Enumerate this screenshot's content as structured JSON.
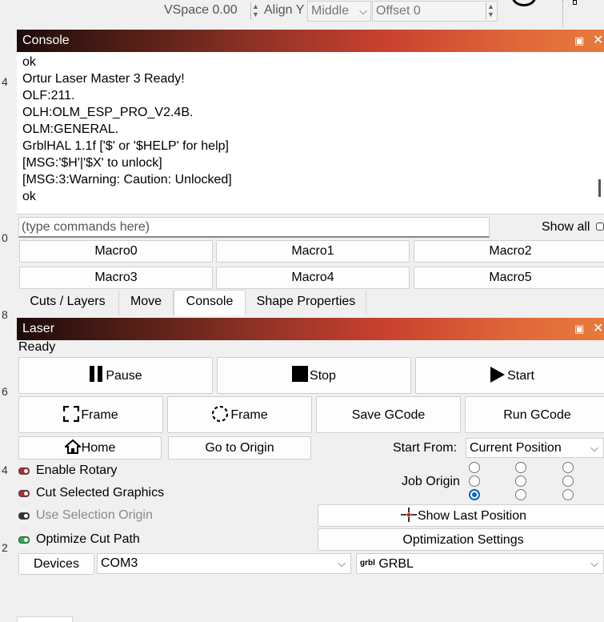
{
  "toolbar": {
    "vspace_label": "VSpace 0.00",
    "align_y_label": "Align Y",
    "align_y_value": "Middle",
    "offset_label": "Offset 0"
  },
  "ruler": {
    "marks": [
      "4",
      "0",
      "8",
      "6",
      "4",
      "2"
    ]
  },
  "console_panel": {
    "title": "Console",
    "lines": [
      "ok",
      "Ortur Laser Master 3 Ready!",
      "OLF:211.",
      "OLH:OLM_ESP_PRO_V2.4B.",
      "OLM:GENERAL.",
      "GrblHAL 1.1f ['$' or '$HELP' for help]",
      "[MSG:'$H'|'$X' to unlock]",
      "[MSG:3:Warning: Caution: Unlocked]",
      "ok"
    ],
    "input_placeholder": "(type commands here)",
    "show_all_label": "Show all",
    "macros": [
      "Macro0",
      "Macro1",
      "Macro2",
      "Macro3",
      "Macro4",
      "Macro5"
    ]
  },
  "tabs": [
    {
      "label": "Cuts / Layers",
      "active": false
    },
    {
      "label": "Move",
      "active": false
    },
    {
      "label": "Console",
      "active": true
    },
    {
      "label": "Shape Properties",
      "active": false
    }
  ],
  "laser_panel": {
    "title": "Laser",
    "status": "Ready",
    "pause_label": "Pause",
    "stop_label": "Stop",
    "start_label": "Start",
    "frame_rect_label": "Frame",
    "frame_circle_label": "Frame",
    "save_gcode_label": "Save GCode",
    "run_gcode_label": "Run GCode",
    "home_label": "Home",
    "go_to_origin_label": "Go to Origin",
    "start_from_label": "Start From:",
    "start_from_value": "Current Position",
    "job_origin_label": "Job Origin",
    "job_origin_selected": "bottom-left",
    "options": [
      {
        "label": "Enable Rotary",
        "led": "red",
        "enabled": true
      },
      {
        "label": "Cut Selected Graphics",
        "led": "red",
        "enabled": true
      },
      {
        "label": "Use Selection Origin",
        "led": "dark",
        "enabled": false
      },
      {
        "label": "Optimize Cut Path",
        "led": "green",
        "enabled": true
      }
    ],
    "show_last_position_label": "Show Last Position",
    "optimization_settings_label": "Optimization Settings",
    "devices_label": "Devices",
    "port_value": "COM3",
    "device_icon_text": "grbl",
    "device_value": "GRBL"
  },
  "colors": {
    "led_red": "#b22a2a",
    "led_green": "#22b14c",
    "led_dark": "#333333",
    "radio_selected": "#0a64c8"
  }
}
